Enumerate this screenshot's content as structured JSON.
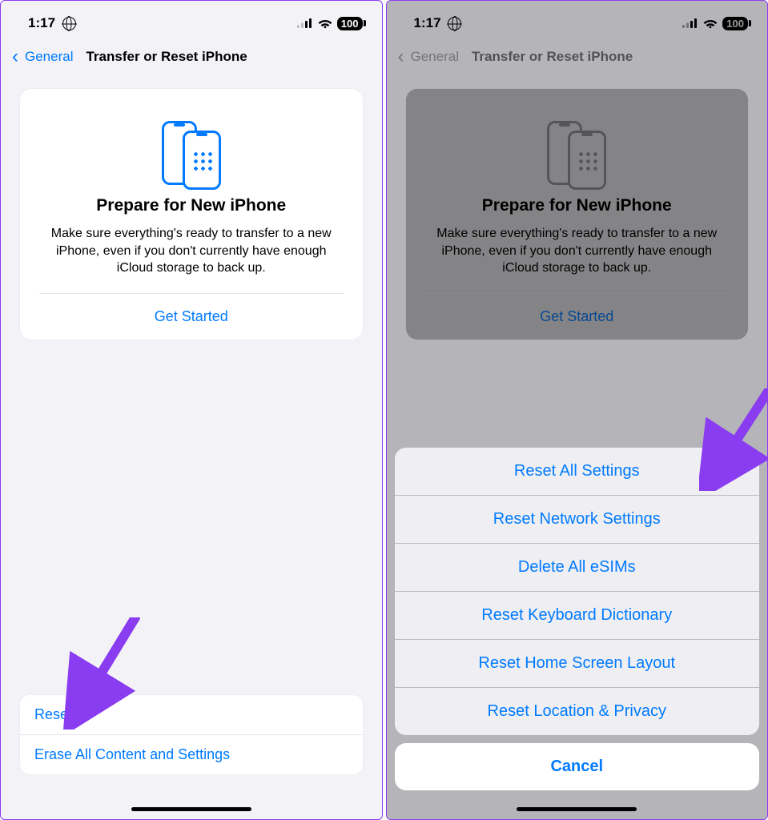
{
  "status": {
    "time": "1:17",
    "battery": "100"
  },
  "nav": {
    "back": "General",
    "title": "Transfer or Reset iPhone"
  },
  "hero": {
    "heading": "Prepare for New iPhone",
    "body": "Make sure everything's ready to transfer to a new iPhone, even if you don't currently have enough iCloud storage to back up.",
    "cta": "Get Started"
  },
  "resetList": {
    "reset": "Reset",
    "erase": "Erase All Content and Settings"
  },
  "sheet": {
    "options": [
      "Reset All Settings",
      "Reset Network Settings",
      "Delete All eSIMs",
      "Reset Keyboard Dictionary",
      "Reset Home Screen Layout",
      "Reset Location & Privacy"
    ],
    "cancel": "Cancel"
  },
  "colors": {
    "accent": "#007aff",
    "arrow": "#8a3cf0"
  }
}
